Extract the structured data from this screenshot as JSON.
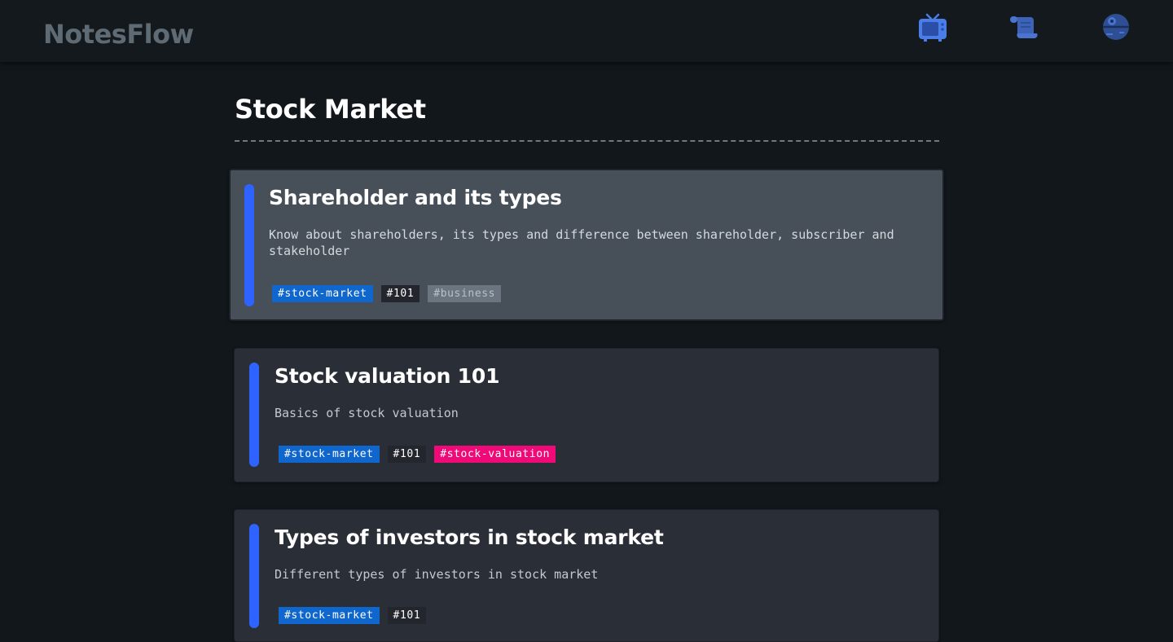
{
  "navbar": {
    "brand": "NotesFlow",
    "icons": [
      {
        "name": "tv-icon",
        "color": "#4a7de8"
      },
      {
        "name": "scroll-icon",
        "color": "#3d63b8"
      },
      {
        "name": "death-star-icon",
        "color": "#2e4f93"
      }
    ]
  },
  "page": {
    "title": "Stock Market"
  },
  "colors": {
    "background": "#11171b",
    "accent": "#2f63ff",
    "card": "#2a2e37",
    "card_hover": "#475059"
  },
  "cards": [
    {
      "title": "Shareholder and its types",
      "description": "Know about shareholders, its types and difference between shareholder, subscriber and stakeholder",
      "tags": [
        {
          "label": "#stock-market",
          "style": "blue"
        },
        {
          "label": "#101",
          "style": "dark"
        },
        {
          "label": "#business",
          "style": "gray"
        }
      ]
    },
    {
      "title": "Stock valuation 101",
      "description": "Basics of stock valuation",
      "tags": [
        {
          "label": "#stock-market",
          "style": "blue"
        },
        {
          "label": "#101",
          "style": "dark"
        },
        {
          "label": "#stock-valuation",
          "style": "pink"
        }
      ]
    },
    {
      "title": "Types of investors in stock market",
      "description": "Different types of investors in stock market",
      "tags": [
        {
          "label": "#stock-market",
          "style": "blue"
        },
        {
          "label": "#101",
          "style": "dark"
        }
      ]
    }
  ]
}
